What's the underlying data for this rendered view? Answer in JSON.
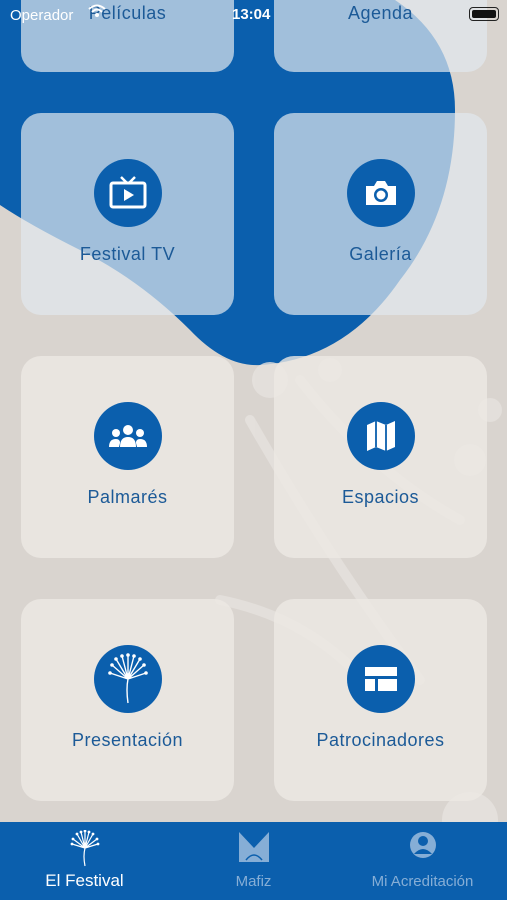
{
  "status_bar": {
    "carrier": "Operador",
    "time": "13:04"
  },
  "menu": {
    "tiles": [
      {
        "id": "peliculas",
        "label": "Películas",
        "icon": "film-icon"
      },
      {
        "id": "agenda",
        "label": "Agenda",
        "icon": "calendar-icon"
      },
      {
        "id": "festival_tv",
        "label": "Festival TV",
        "icon": "tv-icon"
      },
      {
        "id": "galeria",
        "label": "Galería",
        "icon": "camera-icon"
      },
      {
        "id": "palmares",
        "label": "Palmarés",
        "icon": "group-icon"
      },
      {
        "id": "espacios",
        "label": "Espacios",
        "icon": "map-icon"
      },
      {
        "id": "presentacion",
        "label": "Presentación",
        "icon": "dandelion-icon"
      },
      {
        "id": "patrocinadores",
        "label": "Patrocinadores",
        "icon": "layout-icon"
      }
    ]
  },
  "tab_bar": {
    "tabs": [
      {
        "label": "El Festival",
        "icon": "dandelion-icon",
        "active": true
      },
      {
        "label": "Mafiz",
        "icon": "mafiz-logo-icon",
        "active": false
      },
      {
        "label": "Mi Acreditación",
        "icon": "user-circle-icon",
        "active": false
      }
    ]
  },
  "colors": {
    "brand_blue": "#0b5fad",
    "background": "#d9d4cf",
    "label_blue": "#1c5a97",
    "tab_inactive": "#86aed6"
  }
}
